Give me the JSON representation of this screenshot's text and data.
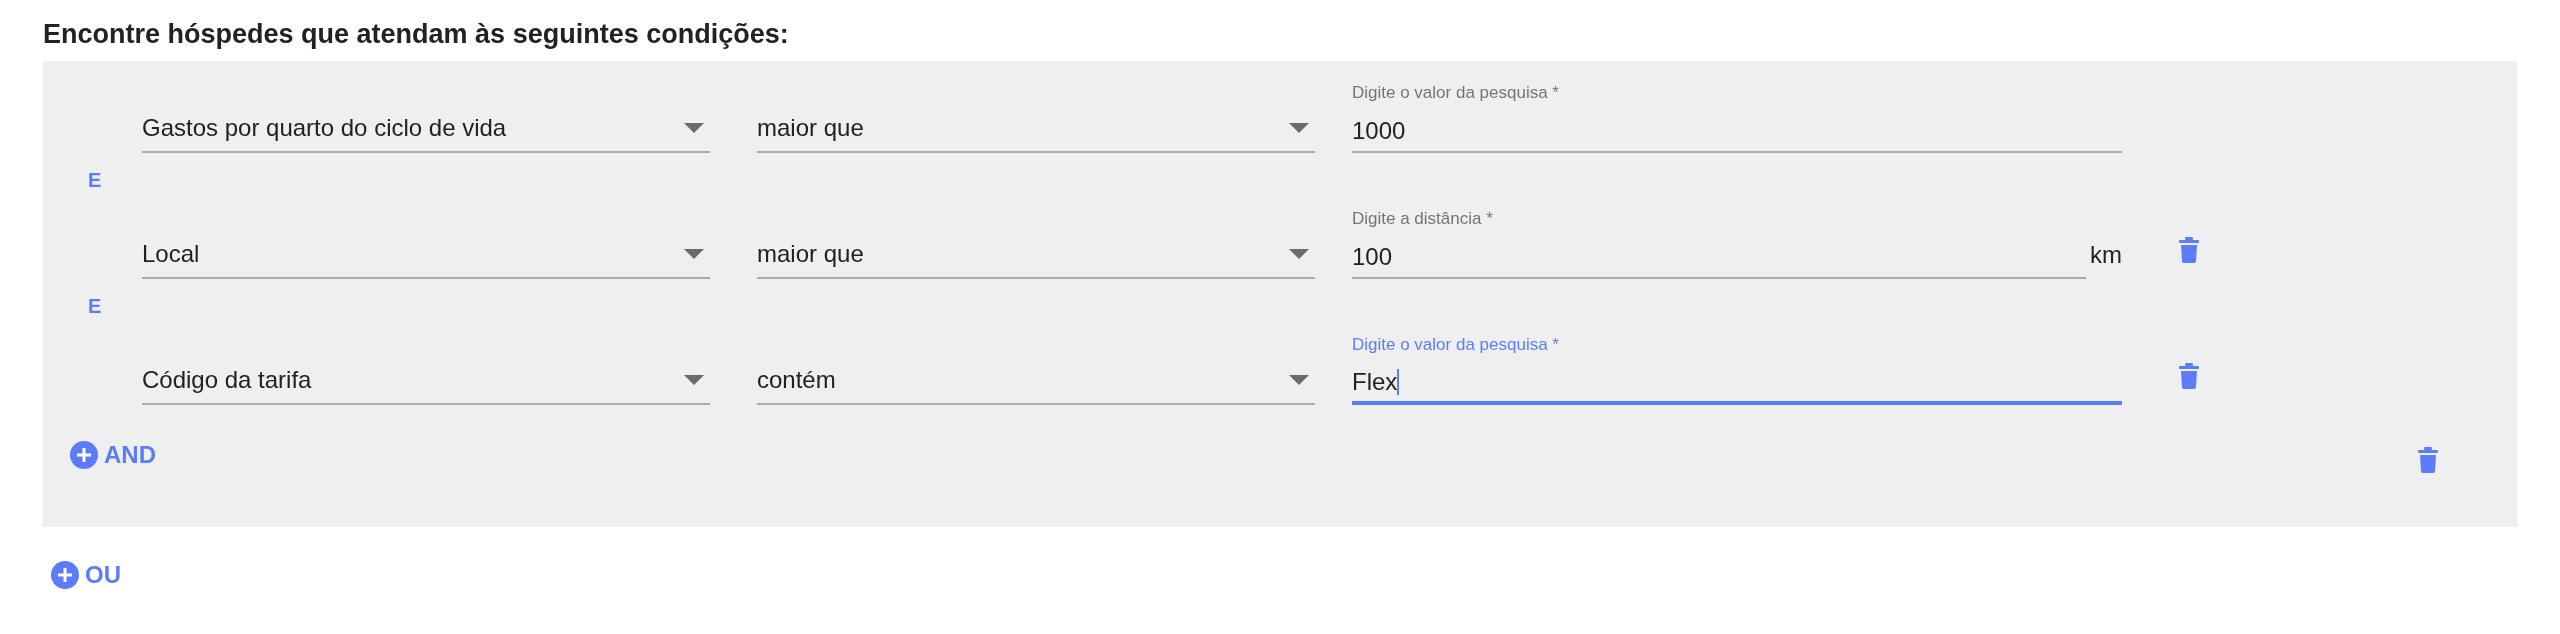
{
  "title": "Encontre hóspedes que atendam às seguintes condições:",
  "group": {
    "conditions": [
      {
        "field": "Gastos por quarto do ciclo de vida",
        "operator": "maior que",
        "value_label": "Digite o valor da pesquisa *",
        "value": "1000",
        "focused": false,
        "deletable": false
      },
      {
        "connector": "E",
        "field": "Local",
        "operator": "maior que",
        "value_label": "Digite a distância *",
        "value": "100",
        "unit": "km",
        "focused": false,
        "deletable": true
      },
      {
        "connector": "E",
        "field": "Código da tarifa",
        "operator": "contém",
        "value_label": "Digite o valor da pesquisa *",
        "value": "Flex",
        "focused": true,
        "deletable": true
      }
    ],
    "add_and": "AND",
    "deletable": true
  },
  "add_or": "OU"
}
